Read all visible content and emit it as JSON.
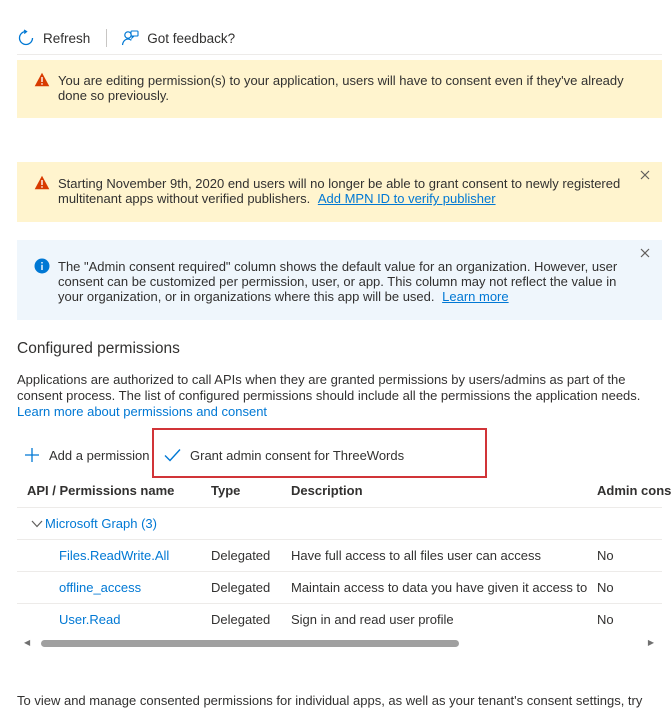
{
  "toolbar": {
    "refresh_label": "Refresh",
    "feedback_label": "Got feedback?"
  },
  "banners": {
    "editing_warning": "You are editing permission(s) to your application, users will have to consent even if they've already done so previously.",
    "publisher_warning_text": "Starting November 9th, 2020 end users will no longer be able to grant consent to newly registered multitenant apps without verified publishers.",
    "publisher_warning_link": "Add MPN ID to verify publisher",
    "admin_info_text": "The \"Admin consent required\" column shows the default value for an organization. However, user consent can be customized per permission, user, or app. This column may not reflect the value in your organization, or in organizations where this app will be used.",
    "admin_info_link": "Learn more"
  },
  "section": {
    "title": "Configured permissions",
    "description": "Applications are authorized to call APIs when they are granted permissions by users/admins as part of the consent process. The list of configured permissions should include all the permissions the application needs.",
    "description_link": "Learn more about permissions and consent"
  },
  "commands": {
    "add_permission": "Add a permission",
    "grant_consent": "Grant admin consent for ThreeWords"
  },
  "table": {
    "headers": [
      "API / Permissions name",
      "Type",
      "Description",
      "Admin cons"
    ],
    "group_label": "Microsoft Graph (3)",
    "rows": [
      {
        "name": "Files.ReadWrite.All",
        "type": "Delegated",
        "description": "Have full access to all files user can access",
        "admin": "No"
      },
      {
        "name": "offline_access",
        "type": "Delegated",
        "description": "Maintain access to data you have given it access to",
        "admin": "No"
      },
      {
        "name": "User.Read",
        "type": "Delegated",
        "description": "Sign in and read user profile",
        "admin": "No"
      }
    ]
  },
  "footer_text": "To view and manage consented permissions for individual apps, as well as your tenant's consent settings, try",
  "colors": {
    "accent": "#0078d4",
    "warning_bg": "#fff4ce",
    "warning_icon": "#d83b01",
    "info_bg": "#eff6fc",
    "highlight_border": "#d13438"
  }
}
